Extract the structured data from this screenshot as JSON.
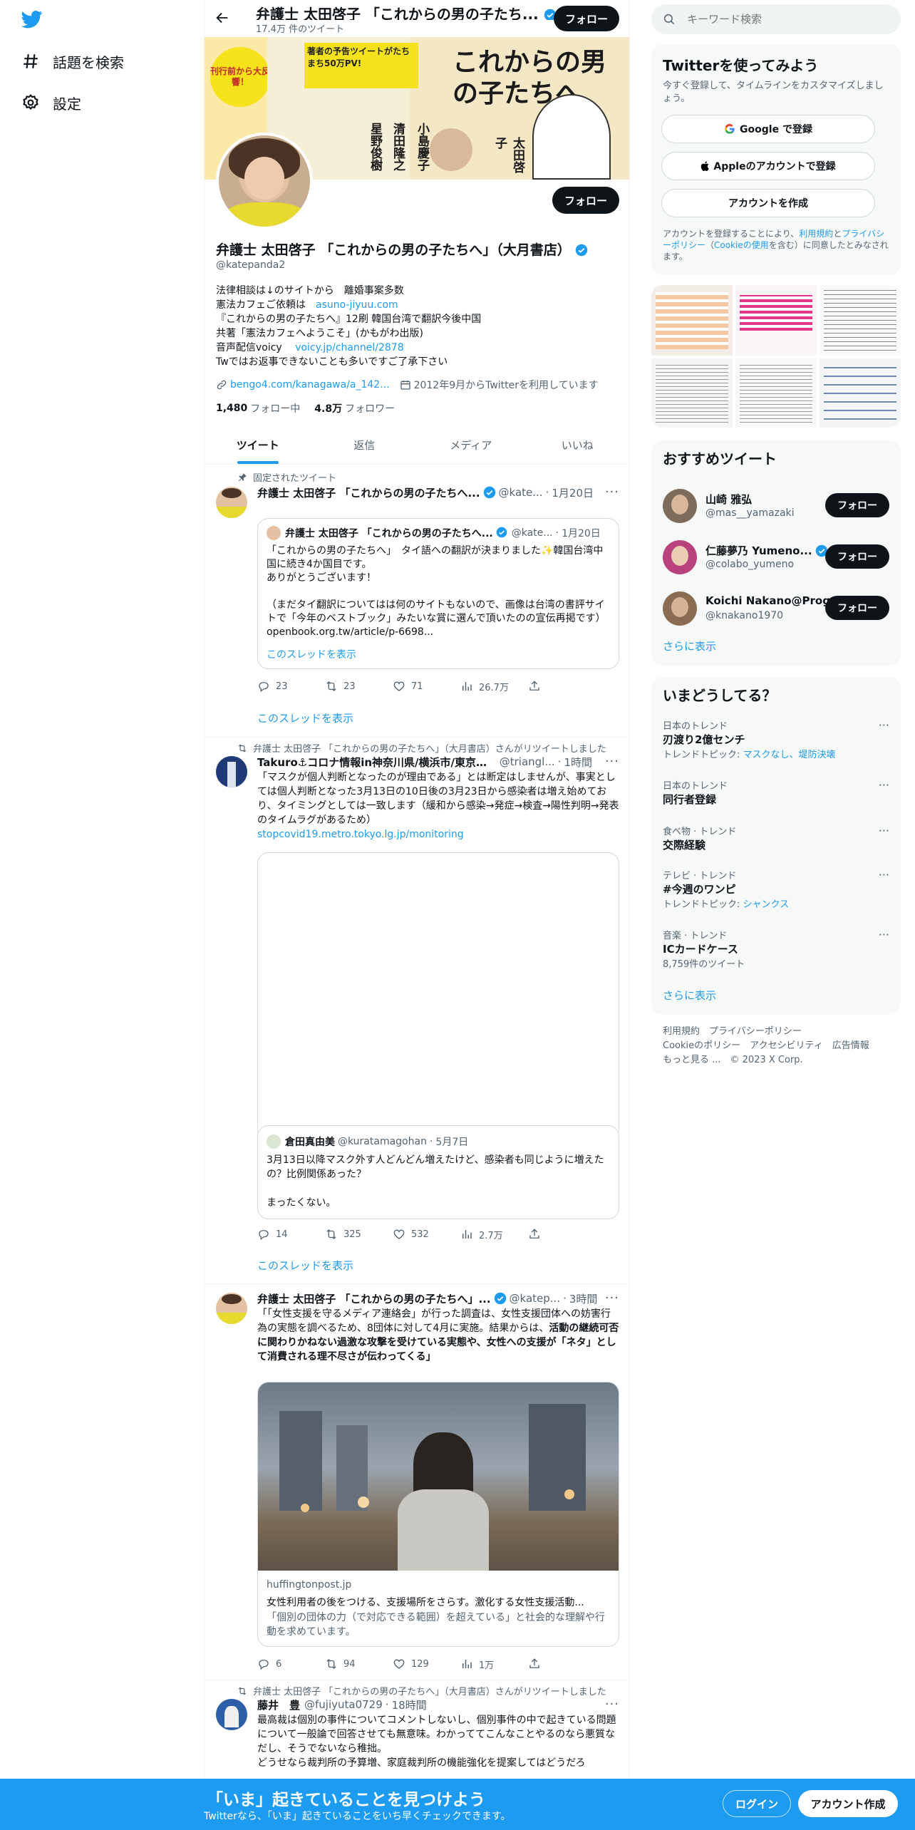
{
  "left_nav": {
    "items": [
      {
        "label": "話題を検索",
        "icon": "hashtag-icon"
      },
      {
        "label": "設定",
        "icon": "gear-icon"
      }
    ]
  },
  "header": {
    "title": "弁護士 太田啓子 「これからの男の子たち...",
    "tweet_count": "17.4万 件のツイート",
    "follow_label": "フォロー"
  },
  "banner": {
    "headline": "これからの男の子たちへ",
    "badge": "刊行前から大反響！",
    "promo": "著者の予告ツイートがたちまち50万PV!",
    "names": [
      "太田啓子",
      "小島慶子",
      "清田隆之",
      "星野俊樹"
    ]
  },
  "profile": {
    "name": "弁護士 太田啓子 「これからの男の子たちへ」（大月書店）",
    "handle": "@katepanda2",
    "follow_label": "フォロー",
    "bio_lines": [
      {
        "text": "法律相談は↓のサイトから　離婚事案多数",
        "link": ""
      },
      {
        "text": "憲法カフェご依頼は　",
        "link": "asuno-jiyuu.com"
      },
      {
        "text": "『これからの男の子たちへ』12刷 韓国台湾で翻訳今後中国",
        "link": ""
      },
      {
        "text": "共著「憲法カフェへようこそ」(かもがわ出版)",
        "link": ""
      },
      {
        "text": "音声配信voicy　 ",
        "link": "voicy.jp/channel/2878"
      },
      {
        "text": "Twではお返事できないことも多いですご了承下さい",
        "link": ""
      }
    ],
    "website": "bengo4.com/kanagawa/a_142...",
    "joined": "2012年9月からTwitterを利用しています",
    "following_count": "1,480",
    "following_label": "フォロー中",
    "followers_count": "4.8万",
    "followers_label": "フォロワー"
  },
  "tabs": [
    {
      "label": "ツイート",
      "active": true
    },
    {
      "label": "返信",
      "active": false
    },
    {
      "label": "メディア",
      "active": false
    },
    {
      "label": "いいね",
      "active": false
    }
  ],
  "tweets": {
    "t1": {
      "context": "固定されたツイート",
      "name": "弁護士 太田啓子 「これからの男の子たちへ...",
      "handle": "@kate...",
      "time": "1月20日",
      "quote": {
        "name": "弁護士 太田啓子 「これからの男の子たちへ...",
        "handle": "@kate...",
        "time": "1月20日",
        "text": "「これからの男の子たちへ」　タイ語への翻訳が決まりました✨韓国台湾中国に続き4か国目です。\nありがとうございます！\n\n（まだタイ翻訳についてはは何のサイトもないので、画像は台湾の書評サイトで「今年のベストブック」みたいな賞に選んで頂いたのの宣伝再掲です）  openbook.org.tw/article/p-6698...",
        "show_thread": "このスレッドを表示"
      },
      "replies": "23",
      "retweets": "23",
      "likes": "71",
      "views": "26.7万",
      "show_thread": "このスレッドを表示"
    },
    "t2": {
      "context": "弁護士 太田啓子 「これからの男の子たちへ」（大月書店）さんがリツイートしました",
      "name": "Takuro⚓コロナ情報in神奈川県/横浜市/東京都(全...",
      "handle": "@triangl...",
      "time": "1時間",
      "text": "「マスクが個人判断となったのが理由である」とは断定はしませんが、事実としては個人判断となった3月13日の10日後の3月23日から感染者は増え始めており、タイミングとしては一致します（緩和から感染→発症→検査→陽性判明→発表のタイムラグがあるため）",
      "link": "stopcovid19.metro.tokyo.lg.jp/monitoring",
      "quote": {
        "name": "倉田真由美",
        "handle": "@kuratamagohan",
        "time": "5月7日",
        "text": "3月13日以降マスク外す人どんどん増えたけど、感染者も同じように増えたの？比例関係あった？\n\nまったくない。"
      },
      "replies": "14",
      "retweets": "325",
      "likes": "532",
      "views": "2.7万",
      "show_thread": "このスレッドを表示"
    },
    "t3": {
      "name": "弁護士 太田啓子 「これからの男の子たちへ」...",
      "handle": "@katep...",
      "time": "3時間",
      "text_plain": "「「女性支援を守るメディア連絡会」が行った調査は、女性支援団体への妨害行為の実態を調べるため、8団体に対して4月に実施。結果からは、",
      "text_bold": "活動の継続可否に関わりかねない過激な攻撃を受けている実態や、女性への支援が「ネタ」として消費される理不尽さが伝わってくる」",
      "card": {
        "domain": "huffingtonpost.jp",
        "title": "女性利用者の後をつける、支援場所をさらす。激化する女性支援活動...",
        "desc": "「個別の団体の力（で対応できる範囲）を超えている」と社会的な理解や行動を求めています。"
      },
      "replies": "6",
      "retweets": "94",
      "likes": "129",
      "views": "1万"
    },
    "t4": {
      "context": "弁護士 太田啓子 「これからの男の子たちへ」（大月書店）さんがリツイートしました",
      "name": "藤井　豊",
      "handle": "@fujiyuta0729",
      "time": "18時間",
      "text": "最高裁は個別の事件についてコメントしないし、個別事件の中で起きている問題について一般論で回答させても無意味。わかっててこんなことやるのなら悪質なだし、そうでないなら稚拙。\nどうせなら裁判所の予算増、家庭裁判所の機能強化を提案してはどうだろ"
    }
  },
  "right": {
    "search_placeholder": "キーワード検索",
    "signup": {
      "title": "Twitterを使ってみよう",
      "desc": "今すぐ登録して、タイムラインをカスタマイズしましょう。",
      "google": "Google で登録",
      "apple": "Appleのアカウントで登録",
      "create": "アカウントを作成",
      "terms_pre": "アカウントを登録することにより、",
      "terms_link1": "利用規約",
      "terms_mid": "と",
      "terms_link2": "プライバシーポリシー",
      "terms_paren": "（",
      "terms_link3": "Cookieの使用",
      "terms_post": "を含む）に同意したとみなされます。"
    },
    "recommended": {
      "title": "おすすめツイート",
      "users": [
        {
          "name": "山崎 雅弘",
          "handle": "@mas__yamazaki",
          "verified": false
        },
        {
          "name": "仁藤夢乃 Yumeno...",
          "handle": "@colabo_yumeno",
          "verified": true
        },
        {
          "name": "Koichi Nakano@Prog...",
          "handle": "@knakano1970",
          "verified": false
        }
      ],
      "follow_label": "フォロー",
      "more": "さらに表示"
    },
    "trends": {
      "title": "いまどうしてる？",
      "items": [
        {
          "context": "日本のトレンド",
          "name": "刃渡り2億センチ",
          "sub_pre": "トレンドトピック: ",
          "sub_link": "マスクなし、堤防決壊"
        },
        {
          "context": "日本のトレンド",
          "name": "同行者登録",
          "sub_pre": "",
          "sub_link": ""
        },
        {
          "context": "食べ物 · トレンド",
          "name": "交際経験",
          "sub_pre": "",
          "sub_link": ""
        },
        {
          "context": "テレビ · トレンド",
          "name": "#今週のワンピ",
          "sub_pre": "トレンドトピック: ",
          "sub_link": "シャンクス"
        },
        {
          "context": "音楽 · トレンド",
          "name": "ICカードケース",
          "sub_pre": "8,759件のツイート",
          "sub_link": ""
        }
      ],
      "more": "さらに表示"
    },
    "footer": {
      "line1": "利用規約　プライバシーポリシー",
      "line2": "Cookieのポリシー　アクセシビリティ　広告情報",
      "line3": "もっと見る ...　© 2023 X Corp."
    }
  },
  "bottom_bar": {
    "title": "「いま」起きていることを見つけよう",
    "subtitle": "Twitterなら、「いま」起きていることをいち早くチェックできます。",
    "login": "ログイン",
    "signup": "アカウント作成"
  },
  "colors": {
    "accent": "#1d9bf0",
    "text": "#0f1419",
    "muted": "#536471"
  }
}
